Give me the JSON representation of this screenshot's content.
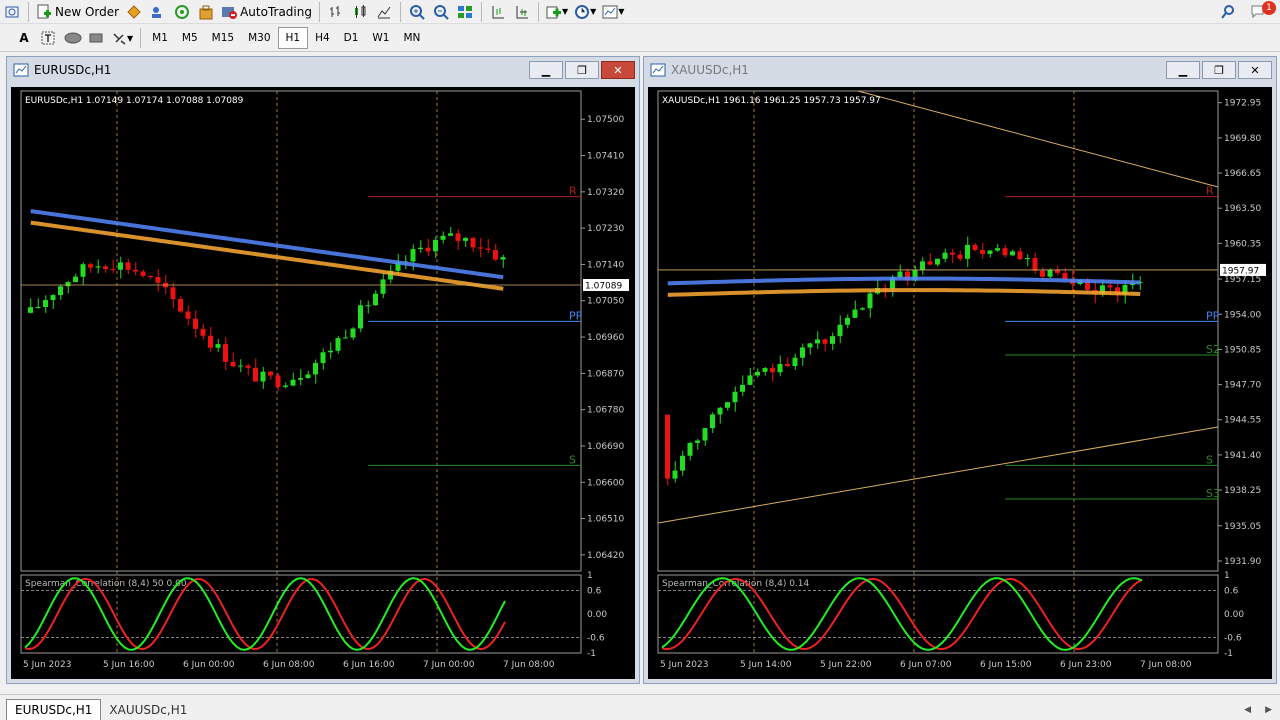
{
  "toolbar": {
    "new_order": "New Order",
    "auto_trading": "AutoTrading",
    "timeframes": [
      "M1",
      "M5",
      "M15",
      "M30",
      "H1",
      "H4",
      "D1",
      "W1",
      "MN"
    ],
    "active_timeframe": "H1",
    "notification_count": "1"
  },
  "tabs": [
    "EURUSDc,H1",
    "XAUUSDc,H1"
  ],
  "active_tab": "EURUSDc,H1",
  "colors": {
    "bull": "#22dd22",
    "bear": "#ee1111",
    "grid": "#555555",
    "chart_bg": "#000000",
    "axis_text": "#c8c8c8",
    "ma_blue": "#5588ff",
    "ma_orange": "#ffaa33",
    "corr_green": "#22ee22",
    "corr_red": "#ee2222",
    "trend": "#d8b060",
    "pivot_blue": "#4488ee"
  },
  "charts": [
    {
      "window_title": "EURUSDc,H1",
      "info": "EURUSDc,H1  1.07149 1.07174 1.07088 1.07089",
      "current_price": "1.07089",
      "level_labels": [
        "R",
        "PP",
        "S"
      ],
      "indicator_label": "Spearman_Correlation (8,4) 50 0.00",
      "focused": true,
      "chart_data": {
        "type": "candlestick",
        "y_ticks": [
          1.075,
          1.0741,
          1.0732,
          1.0723,
          1.0714,
          1.0705,
          1.0696,
          1.0687,
          1.0678,
          1.0669,
          1.066,
          1.0651,
          1.0642
        ],
        "y_tick_labels": [
          "1.07500",
          "1.07410",
          "1.07320",
          "1.07230",
          "1.07140",
          "1.07050",
          "1.06960",
          "1.06870",
          "1.06780",
          "1.06690",
          "1.06600",
          "1.06510",
          "1.06420"
        ],
        "ylim": [
          1.0638,
          1.0757
        ],
        "x_labels": [
          "5 Jun 2023",
          "5 Jun 16:00",
          "6 Jun 00:00",
          "6 Jun 08:00",
          "6 Jun 16:00",
          "7 Jun 00:00",
          "7 Jun 08:00"
        ],
        "close_start": 1.0702,
        "close_end": 1.07089,
        "close_low": 1.0668,
        "indicator_ticks": [
          "1",
          "0.6",
          "0.00",
          "-0.6",
          "-1"
        ]
      }
    },
    {
      "window_title": "XAUUSDc,H1",
      "info": "XAUUSDc,H1  1961.16 1961.25 1957.73 1957.97",
      "current_price": "1957.97",
      "level_labels": [
        "R",
        "PP",
        "S",
        "S2",
        "S3"
      ],
      "indicator_label": "Spearman_Correlation (8,4) 0.14",
      "focused": false,
      "chart_data": {
        "type": "candlestick",
        "y_ticks": [
          1972.95,
          1969.8,
          1966.65,
          1963.5,
          1960.35,
          1957.15,
          1954.0,
          1950.85,
          1947.7,
          1944.55,
          1941.4,
          1938.25,
          1935.05,
          1931.9
        ],
        "y_tick_labels": [
          "1972.95",
          "1969.80",
          "1966.65",
          "1963.50",
          "1960.35",
          "1957.15",
          "1954.00",
          "1950.85",
          "1947.70",
          "1944.55",
          "1941.40",
          "1938.25",
          "1935.05",
          "1931.90"
        ],
        "ylim": [
          1931.0,
          1974.0
        ],
        "x_labels": [
          "5 Jun 2023",
          "5 Jun 14:00",
          "5 Jun 22:00",
          "6 Jun 07:00",
          "6 Jun 15:00",
          "6 Jun 23:00",
          "7 Jun 08:00"
        ],
        "close_start": 1945.0,
        "close_end": 1957.97,
        "close_low": 1939.5,
        "indicator_ticks": [
          "1",
          "0.6",
          "0.00",
          "-0.6",
          "-1"
        ]
      }
    }
  ]
}
